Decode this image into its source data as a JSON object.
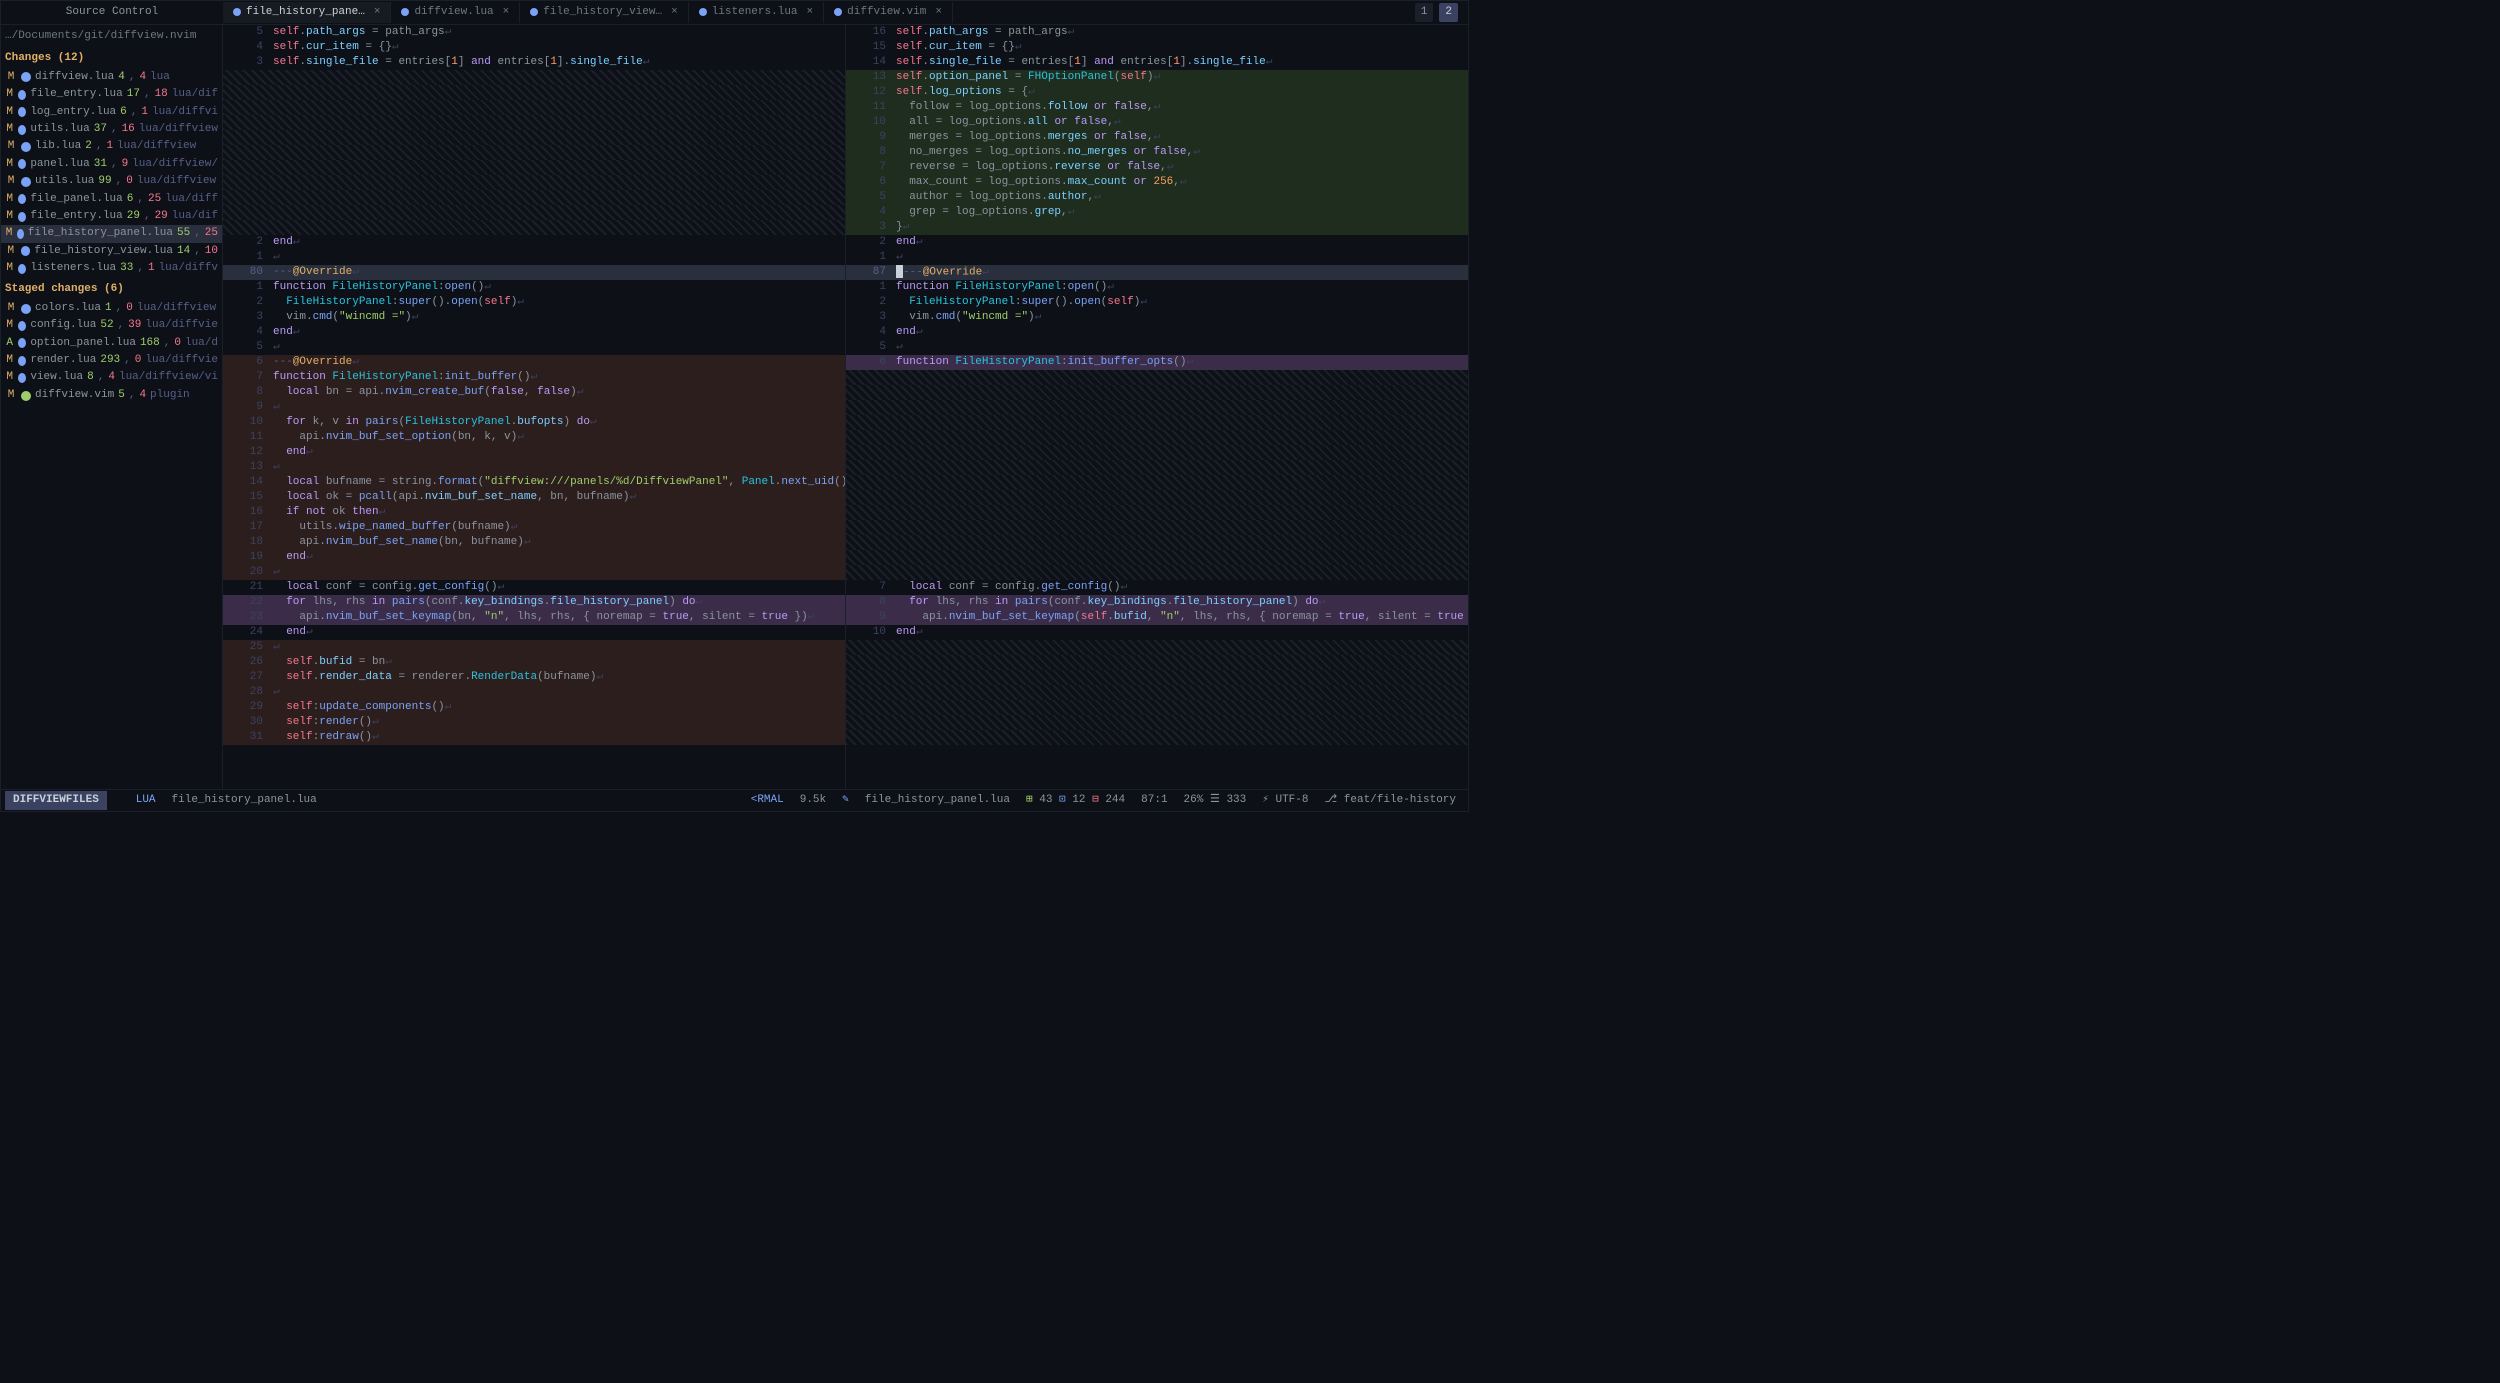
{
  "header": {
    "sidebar_title": "Source Control",
    "tabs": [
      {
        "label": "file_history_pane…",
        "active": true,
        "close": "×"
      },
      {
        "label": "diffview.lua",
        "active": false,
        "close": "×"
      },
      {
        "label": "file_history_view…",
        "active": false,
        "close": "×"
      },
      {
        "label": "listeners.lua",
        "active": false,
        "close": "×"
      },
      {
        "label": "diffview.vim",
        "active": false,
        "close": "×"
      }
    ],
    "pages": [
      "1",
      "2"
    ]
  },
  "sidebar": {
    "path": "…/Documents/git/diffview.nvim",
    "changes_title": "Changes (12)",
    "changes": [
      {
        "s": "M",
        "name": "diffview.lua",
        "a": "4",
        "b": "4",
        "p": "lua"
      },
      {
        "s": "M",
        "name": "file_entry.lua",
        "a": "17",
        "b": "18",
        "p": "lua/dif"
      },
      {
        "s": "M",
        "name": "log_entry.lua",
        "a": "6",
        "b": "1",
        "p": "lua/diffvi"
      },
      {
        "s": "M",
        "name": "utils.lua",
        "a": "37",
        "b": "16",
        "p": "lua/diffview"
      },
      {
        "s": "M",
        "name": "lib.lua",
        "a": "2",
        "b": "1",
        "p": "lua/diffview"
      },
      {
        "s": "M",
        "name": "panel.lua",
        "a": "31",
        "b": "9",
        "p": "lua/diffview/"
      },
      {
        "s": "M",
        "name": "utils.lua",
        "a": "99",
        "b": "0",
        "p": "lua/diffview"
      },
      {
        "s": "M",
        "name": "file_panel.lua",
        "a": "6",
        "b": "25",
        "p": "lua/diff"
      },
      {
        "s": "M",
        "name": "file_entry.lua",
        "a": "29",
        "b": "29",
        "p": "lua/dif"
      },
      {
        "s": "M",
        "name": "file_history_panel.lua",
        "a": "55",
        "b": "25",
        "sel": true
      },
      {
        "s": "M",
        "name": "file_history_view.lua",
        "a": "14",
        "b": "10"
      },
      {
        "s": "M",
        "name": "listeners.lua",
        "a": "33",
        "b": "1",
        "p": "lua/diffv"
      }
    ],
    "staged_title": "Staged changes (6)",
    "staged": [
      {
        "s": "M",
        "name": "colors.lua",
        "a": "1",
        "b": "0",
        "p": "lua/diffview"
      },
      {
        "s": "M",
        "name": "config.lua",
        "a": "52",
        "b": "39",
        "p": "lua/diffvie"
      },
      {
        "s": "A",
        "name": "option_panel.lua",
        "a": "168",
        "b": "0",
        "p": "lua/d"
      },
      {
        "s": "M",
        "name": "render.lua",
        "a": "293",
        "b": "0",
        "p": "lua/diffvie"
      },
      {
        "s": "M",
        "name": "view.lua",
        "a": "8",
        "b": "4",
        "p": "lua/diffview/vi"
      },
      {
        "s": "M",
        "name": "diffview.vim",
        "a": "5",
        "b": "4",
        "p": "plugin",
        "vim": true
      }
    ]
  },
  "left_pane": {
    "lines": [
      {
        "n": "5",
        "t": "self.path_args = path_args"
      },
      {
        "n": "4",
        "t": "self.cur_item = {}"
      },
      {
        "n": "3",
        "t": "self.single_file = entries[1] and entries[1].single_file"
      },
      {
        "diag": true
      },
      {
        "diag": true
      },
      {
        "diag": true
      },
      {
        "diag": true
      },
      {
        "diag": true
      },
      {
        "diag": true
      },
      {
        "diag": true
      },
      {
        "diag": true
      },
      {
        "diag": true
      },
      {
        "diag": true
      },
      {
        "diag": true
      },
      {
        "n": "2",
        "t": "end"
      },
      {
        "n": "1",
        "t": ""
      },
      {
        "n": "80",
        "t": "---@Override",
        "cur": true
      },
      {
        "n": "1",
        "t": "function FileHistoryPanel:open()"
      },
      {
        "n": "2",
        "t": "  FileHistoryPanel:super().open(self)"
      },
      {
        "n": "3",
        "t": "  vim.cmd(\"wincmd =\")"
      },
      {
        "n": "4",
        "t": "end"
      },
      {
        "n": "5",
        "t": ""
      },
      {
        "n": "6",
        "t": "---@Override",
        "del": true
      },
      {
        "n": "7",
        "t": "function FileHistoryPanel:init_buffer()",
        "del": true
      },
      {
        "n": "8",
        "t": "  local bn = api.nvim_create_buf(false, false)",
        "del": true
      },
      {
        "n": "9",
        "t": "",
        "del": true
      },
      {
        "n": "10",
        "t": "  for k, v in pairs(FileHistoryPanel.bufopts) do",
        "del": true
      },
      {
        "n": "11",
        "t": "    api.nvim_buf_set_option(bn, k, v)",
        "del": true
      },
      {
        "n": "12",
        "t": "  end",
        "del": true
      },
      {
        "n": "13",
        "t": "",
        "del": true
      },
      {
        "n": "14",
        "t": "  local bufname = string.format(\"diffview:///panels/%d/DiffviewPanel\", Panel.next_uid())",
        "del": true
      },
      {
        "n": "15",
        "t": "  local ok = pcall(api.nvim_buf_set_name, bn, bufname)",
        "del": true
      },
      {
        "n": "16",
        "t": "  if not ok then",
        "del": true
      },
      {
        "n": "17",
        "t": "    utils.wipe_named_buffer(bufname)",
        "del": true
      },
      {
        "n": "18",
        "t": "    api.nvim_buf_set_name(bn, bufname)",
        "del": true
      },
      {
        "n": "19",
        "t": "  end",
        "del": true
      },
      {
        "n": "20",
        "t": "",
        "del": true
      },
      {
        "n": "21",
        "t": "  local conf = config.get_config()"
      },
      {
        "n": "22",
        "t": "  for lhs, rhs in pairs(conf.key_bindings.file_history_panel) do",
        "chg": true
      },
      {
        "n": "23",
        "t": "    api.nvim_buf_set_keymap(bn, \"n\", lhs, rhs, { noremap = true, silent = true })",
        "chg": true
      },
      {
        "n": "24",
        "t": "  end"
      },
      {
        "n": "25",
        "t": "",
        "del": true
      },
      {
        "n": "26",
        "t": "  self.bufid = bn",
        "del": true
      },
      {
        "n": "27",
        "t": "  self.render_data = renderer.RenderData(bufname)",
        "del": true
      },
      {
        "n": "28",
        "t": "",
        "del": true
      },
      {
        "n": "29",
        "t": "  self:update_components()",
        "del": true
      },
      {
        "n": "30",
        "t": "  self:render()",
        "del": true
      },
      {
        "n": "31",
        "t": "  self:redraw()",
        "del": true
      }
    ]
  },
  "right_pane": {
    "lines": [
      {
        "n": "16",
        "t": "self.path_args = path_args"
      },
      {
        "n": "15",
        "t": "self.cur_item = {}"
      },
      {
        "n": "14",
        "t": "self.single_file = entries[1] and entries[1].single_file"
      },
      {
        "n": "13",
        "t": "self.option_panel = FHOptionPanel(self)",
        "add": true
      },
      {
        "n": "12",
        "t": "self.log_options = {",
        "add": true
      },
      {
        "n": "11",
        "t": "  follow = log_options.follow or false,",
        "add": true
      },
      {
        "n": "10",
        "t": "  all = log_options.all or false,",
        "add": true
      },
      {
        "n": "9",
        "t": "  merges = log_options.merges or false,",
        "add": true
      },
      {
        "n": "8",
        "t": "  no_merges = log_options.no_merges or false,",
        "add": true
      },
      {
        "n": "7",
        "t": "  reverse = log_options.reverse or false,",
        "add": true
      },
      {
        "n": "6",
        "t": "  max_count = log_options.max_count or 256,",
        "add": true
      },
      {
        "n": "5",
        "t": "  author = log_options.author,",
        "add": true
      },
      {
        "n": "4",
        "t": "  grep = log_options.grep,",
        "add": true
      },
      {
        "n": "3",
        "t": "}",
        "add": true
      },
      {
        "n": "2",
        "t": "end"
      },
      {
        "n": "1",
        "t": ""
      },
      {
        "n": "87",
        "t": "---@Override",
        "cur": true
      },
      {
        "n": "1",
        "t": "function FileHistoryPanel:open()"
      },
      {
        "n": "2",
        "t": "  FileHistoryPanel:super().open(self)"
      },
      {
        "n": "3",
        "t": "  vim.cmd(\"wincmd =\")"
      },
      {
        "n": "4",
        "t": "end"
      },
      {
        "n": "5",
        "t": ""
      },
      {
        "n": "6",
        "t": "function FileHistoryPanel:init_buffer_opts()",
        "chg": true
      },
      {
        "diag": true
      },
      {
        "diag": true
      },
      {
        "diag": true
      },
      {
        "diag": true
      },
      {
        "diag": true
      },
      {
        "diag": true
      },
      {
        "diag": true
      },
      {
        "diag": true
      },
      {
        "diag": true
      },
      {
        "diag": true
      },
      {
        "diag": true
      },
      {
        "diag": true
      },
      {
        "diag": true
      },
      {
        "diag": true
      },
      {
        "n": "7",
        "t": "  local conf = config.get_config()"
      },
      {
        "n": "8",
        "t": "  for lhs, rhs in pairs(conf.key_bindings.file_history_panel) do",
        "chg": true
      },
      {
        "n": "9",
        "t": "    api.nvim_buf_set_keymap(self.bufid, \"n\", lhs, rhs, { noremap = true, silent = true })",
        "chg": true
      },
      {
        "n": "10",
        "t": "end"
      },
      {
        "diag": true
      },
      {
        "diag": true
      },
      {
        "diag": true
      },
      {
        "diag": true
      },
      {
        "diag": true
      },
      {
        "diag": true
      },
      {
        "diag": true
      }
    ]
  },
  "status": {
    "left_mode": "DIFFVIEWFILES",
    "lang": "LUA",
    "filename": "file_history_panel.lua",
    "mode": "<RMAL",
    "size": "9.5k",
    "filepath": "file_history_panel.lua",
    "git_add": "43",
    "git_mod": "12",
    "git_del": "244",
    "pos": "87:1",
    "pct": "26%",
    "total": "333",
    "enc": "UTF-8",
    "branch": "feat/file-history"
  }
}
